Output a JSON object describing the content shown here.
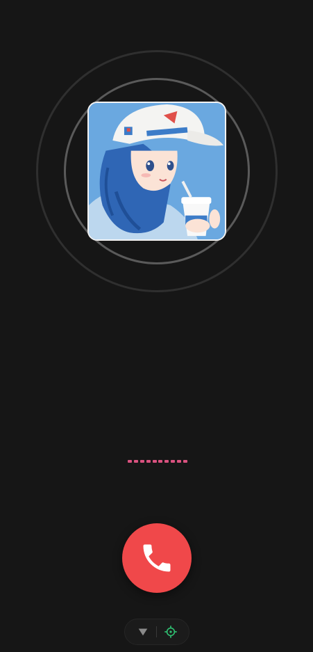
{
  "call": {
    "status_dots": 10,
    "accent_color": "#d9527f",
    "hangup_color": "#f0484a",
    "avatar_alt": ""
  },
  "icons": {
    "hangup": "phone-hangup-icon",
    "collapse": "chevron-down-icon",
    "locate": "crosshair-icon"
  },
  "colors": {
    "background": "#161616",
    "ring_outer": "#2f2f2f",
    "ring_inner": "#5a5a5a",
    "locate_icon": "#2fbf71"
  }
}
